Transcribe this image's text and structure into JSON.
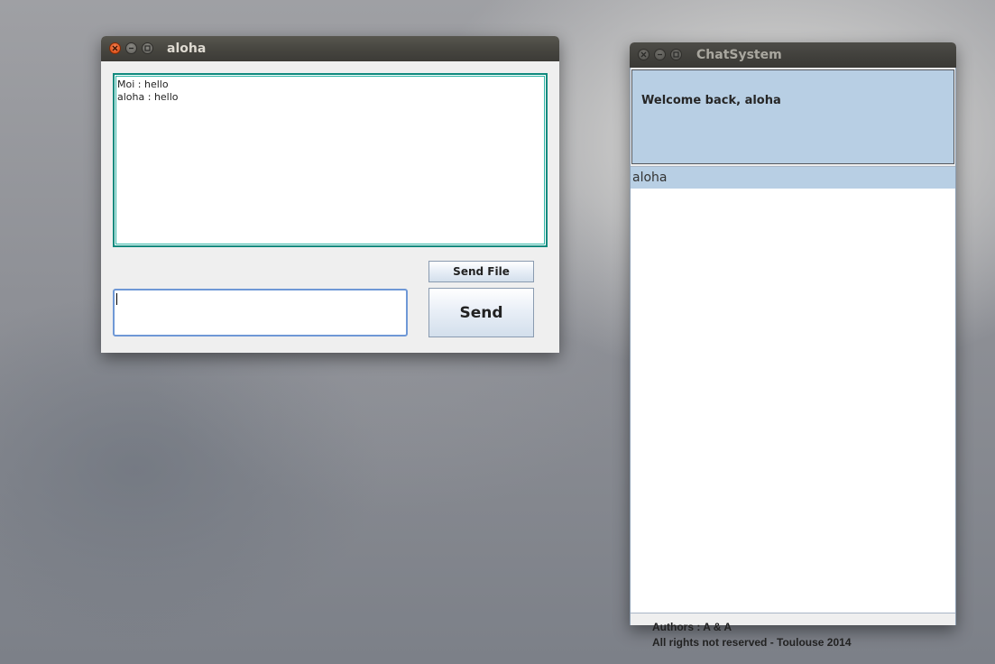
{
  "chat_window": {
    "title": "aloha",
    "history": [
      "Moi : hello",
      "aloha : hello"
    ],
    "message_input": {
      "value": "",
      "placeholder": ""
    },
    "send_file_label": "Send File",
    "send_label": "Send"
  },
  "system_window": {
    "title": "ChatSystem",
    "welcome": "Welcome back, aloha",
    "users": [
      {
        "name": "aloha",
        "selected": true
      }
    ],
    "footer": {
      "authors": "Authors : A & A",
      "rights": "All rights not reserved - Toulouse 2014"
    }
  },
  "colors": {
    "active_close": "#e0541d",
    "history_border": "#0f8a7e",
    "input_focus": "#6f98d6",
    "selection": "#b8cfe4"
  }
}
